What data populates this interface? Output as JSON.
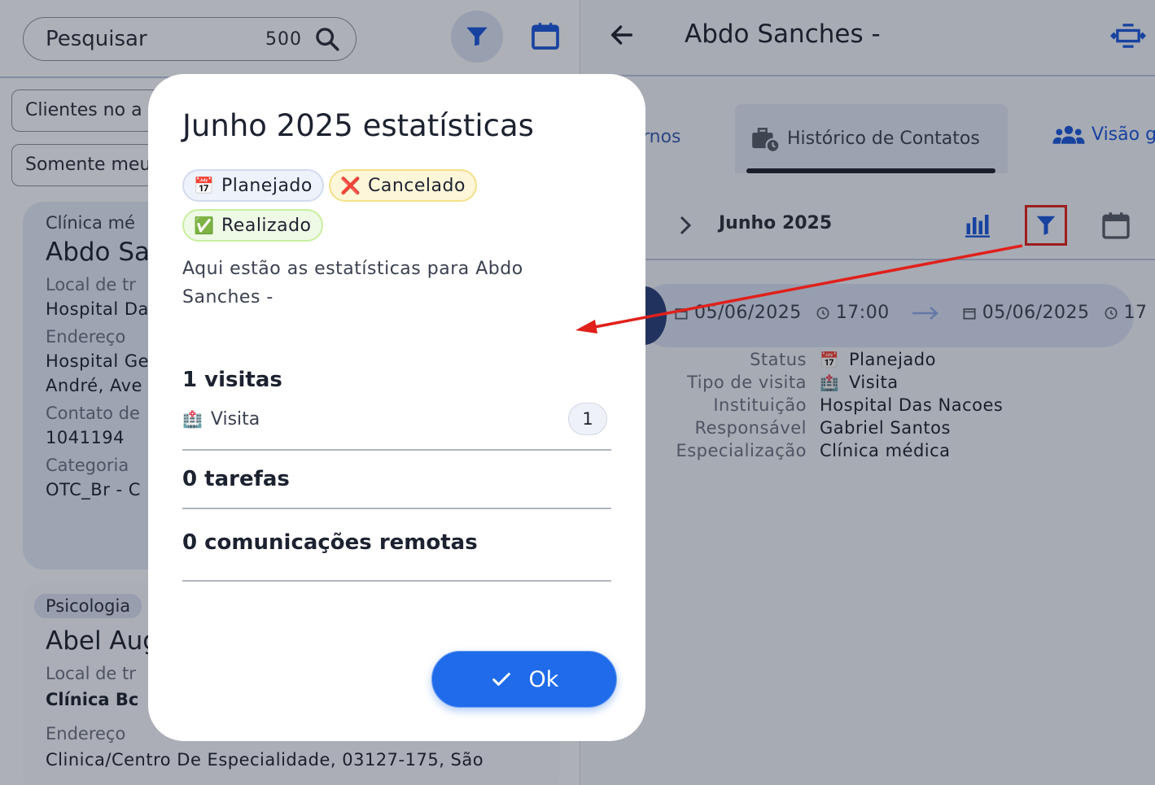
{
  "left": {
    "search": {
      "placeholder": "Pesquisar",
      "count": "500"
    },
    "filter_chips": [
      "Clientes no a",
      "Somente meu"
    ],
    "card1": {
      "category": "Clínica mé",
      "name": "Abdo Sa",
      "workplace_label": "Local de tr",
      "workplace_value": "Hospital Da",
      "address_label": "Endereço",
      "address_line1": "Hospital Ge",
      "address_line2": "André, Ave",
      "contact_label": "Contato de",
      "contact_value": "1041194",
      "category_label": "Categoria",
      "category_value": "OTC_Br - C"
    },
    "card2": {
      "category": "Psicologia",
      "name": "Abel Aug",
      "workplace_label": "Local de tr",
      "workplace_value": "Clínica Bc",
      "address_label": "Endereço",
      "address_value": "Clinica/Centro De Especialidade, 03127-175, São"
    }
  },
  "right": {
    "title": "Abdo Sanches -",
    "tabs": {
      "prev": "rnos",
      "active": "Histórico de Contatos",
      "next": "Visão g"
    },
    "month": "Junho 2025",
    "event": {
      "start_date": "05/06/2025",
      "start_time": "17:00",
      "end_date": "05/06/2025",
      "end_time_partial": "17"
    },
    "details": [
      {
        "key": "Status",
        "icon": "📅",
        "value": "Planejado"
      },
      {
        "key": "Tipo de visita",
        "icon": "🏥",
        "value": "Visita"
      },
      {
        "key": "Instituição",
        "icon": "",
        "value": "Hospital Das Nacoes"
      },
      {
        "key": "Responsável",
        "icon": "",
        "value": "Gabriel Santos"
      },
      {
        "key": "Especialização",
        "icon": "",
        "value": "Clínica médica"
      }
    ]
  },
  "dialog": {
    "title": "Junho 2025 estatísticas",
    "badges": [
      {
        "emoji": "📅",
        "label": "Planejado"
      },
      {
        "emoji": "❌",
        "label": "Cancelado"
      },
      {
        "emoji": "✅",
        "label": "Realizado"
      }
    ],
    "description": "Aqui estão as estatísticas para Abdo Sanches -",
    "visits_heading": "1 visitas",
    "visit_type": {
      "emoji": "🏥",
      "label": "Visita",
      "count": "1"
    },
    "tasks_heading": "0 tarefas",
    "remote_heading": "0 comunicações remotas",
    "ok_label": "Ok"
  },
  "colors": {
    "primary": "#1f6bea",
    "highlight": "#e0201b",
    "accent_blue": "#1a56db"
  }
}
